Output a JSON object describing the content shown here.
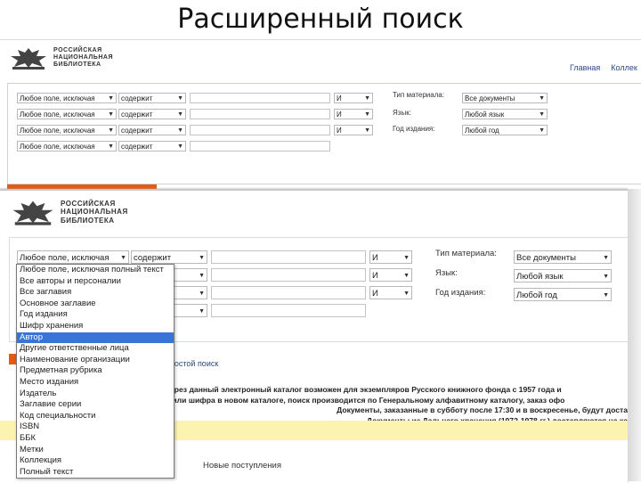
{
  "slide_title": "Расширенный поиск",
  "logo_lines": [
    "РОССИЙСКАЯ",
    "НАЦИОНАЛЬНАЯ",
    "БИБЛИОТЕКА"
  ],
  "nav": [
    "Главная",
    "Коллек"
  ],
  "panel1": {
    "field_select": "Любое поле, исключая",
    "mode_select": "содержит",
    "op_select": "И",
    "right_labels": [
      "Тип материала:",
      "Язык:",
      "Год издания:"
    ],
    "right_values": [
      "Все документы",
      "Любой язык",
      "Любой год"
    ]
  },
  "panel2": {
    "field_select": "Любое поле, исключая",
    "mode_select": "содержит",
    "op_select": "И",
    "right_labels": [
      "Тип материала:",
      "Язык:",
      "Год издания:"
    ],
    "right_values": [
      "Все документы",
      "Любой язык",
      "Любой год"
    ],
    "dropdown_options": [
      "Любое поле, исключая полный текст",
      "Все авторы и персоналии",
      "Все заглавия",
      "Основное заглавие",
      "Год издания",
      "Шифр хранения",
      "Автор",
      "Другие ответственные лица",
      "Наименование организации",
      "Предметная рубрика",
      "Место издания",
      "Издатель",
      "Заглавие серии",
      "Код специальности",
      "ISBN",
      "ББК",
      "Метки",
      "Коллекция",
      "Полный текст"
    ],
    "dropdown_selected": "Автор",
    "simple_search_link": "простой поиск",
    "notice_lines": [
      "через данный электронный каталог возможен для экземпляров Русского книжного фонда с 1957 года и",
      "я или шифра в новом каталоге, поиск производится по Генеральному алфавитному каталогу, заказ офо",
      "Документы, заказанные в субботу после 17:30 и в воскресенье, будут доста",
      "Документы из Дальнего хранения (1972-1978 гг.) доставляются на ка"
    ],
    "news_heading": "Новые поступления"
  },
  "colors": {
    "accent_orange": "#e45a10",
    "selected_blue": "#3875d7",
    "notice_yellow": "#fdf3b0",
    "link_blue": "#2a4a80"
  }
}
